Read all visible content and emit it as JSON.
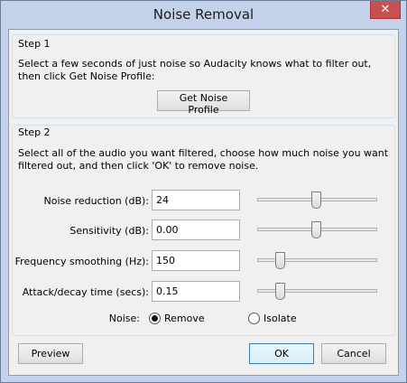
{
  "window": {
    "title": "Noise Removal",
    "close_glyph": "✕"
  },
  "step1": {
    "title": "Step 1",
    "line1": "Select a few seconds of just noise so Audacity knows what to filter out,",
    "line2": "then click Get Noise Profile:",
    "button": "Get Noise Profile"
  },
  "step2": {
    "title": "Step 2",
    "line1": "Select all of the audio you want filtered, choose how much noise you want",
    "line2": "filtered out, and then click 'OK' to remove noise.",
    "noise_reduction": {
      "label": "Noise reduction (dB):",
      "value": "24",
      "slider_fraction": 0.49
    },
    "sensitivity": {
      "label": "Sensitivity (dB):",
      "value": "0.00",
      "slider_fraction": 0.49
    },
    "frequency_smoothing": {
      "label": "Frequency smoothing (Hz):",
      "value": "150",
      "slider_fraction": 0.16
    },
    "attack_decay": {
      "label": "Attack/decay time (secs):",
      "value": "0.15",
      "slider_fraction": 0.16
    },
    "noise": {
      "label": "Noise:",
      "remove": "Remove",
      "isolate": "Isolate",
      "selected": "remove"
    }
  },
  "buttons": {
    "preview": "Preview",
    "ok": "OK",
    "cancel": "Cancel"
  }
}
